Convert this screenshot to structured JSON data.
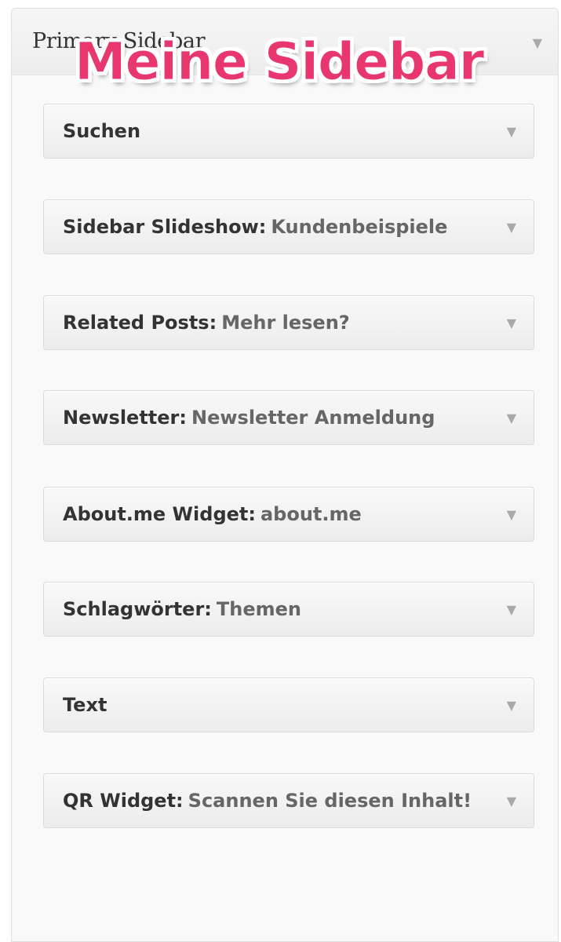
{
  "panel": {
    "title": "Primary Sidebar",
    "toggle_icon": "triangle-down"
  },
  "overlay": {
    "text": "Meine Sidebar",
    "color": "#e8366f"
  },
  "widgets": [
    {
      "name": "Suchen",
      "separator": "",
      "subtitle": ""
    },
    {
      "name": "Sidebar Slideshow",
      "separator": ":",
      "subtitle": "Kundenbeispiele"
    },
    {
      "name": "Related Posts",
      "separator": ":",
      "subtitle": "Mehr lesen?"
    },
    {
      "name": "Newsletter",
      "separator": ":",
      "subtitle": "Newsletter Anmeldung"
    },
    {
      "name": "About.me Widget",
      "separator": ":",
      "subtitle": "about.me"
    },
    {
      "name": "Schlagwörter",
      "separator": ":",
      "subtitle": "Themen"
    },
    {
      "name": "Text",
      "separator": "",
      "subtitle": ""
    },
    {
      "name": "QR Widget",
      "separator": ":",
      "subtitle": "Scannen Sie diesen Inhalt!"
    }
  ],
  "arrow_glyph": "▼"
}
